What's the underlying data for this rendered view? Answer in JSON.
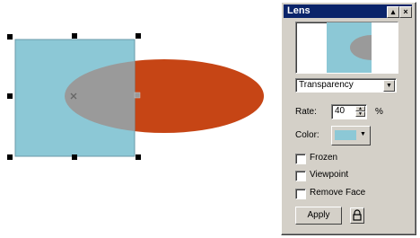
{
  "lens_panel": {
    "title": "Lens",
    "mode_select": {
      "value": "Transparency"
    },
    "rate": {
      "label": "Rate:",
      "value": "40",
      "unit": "%"
    },
    "color": {
      "label": "Color:",
      "swatch_color": "#8cc8d6"
    },
    "checkboxes": [
      {
        "label": "Frozen",
        "checked": false
      },
      {
        "label": "Viewpoint",
        "checked": false
      },
      {
        "label": "Remove Face",
        "checked": false
      }
    ],
    "apply_label": "Apply",
    "titlebar_buttons": {
      "pin": "▴",
      "close": "×"
    }
  },
  "colors": {
    "rectangle_fill": "#8cc8d6",
    "ellipse_fill": "#c64515",
    "overlap_fill": "#9a9a9a",
    "panel_bg": "#d4d0c8",
    "titlebar_bg": "#0a246a"
  },
  "icons": {
    "center_marker": "x-marker-icon",
    "lock": "lock-icon",
    "dropdown": "chevron-down-icon"
  }
}
